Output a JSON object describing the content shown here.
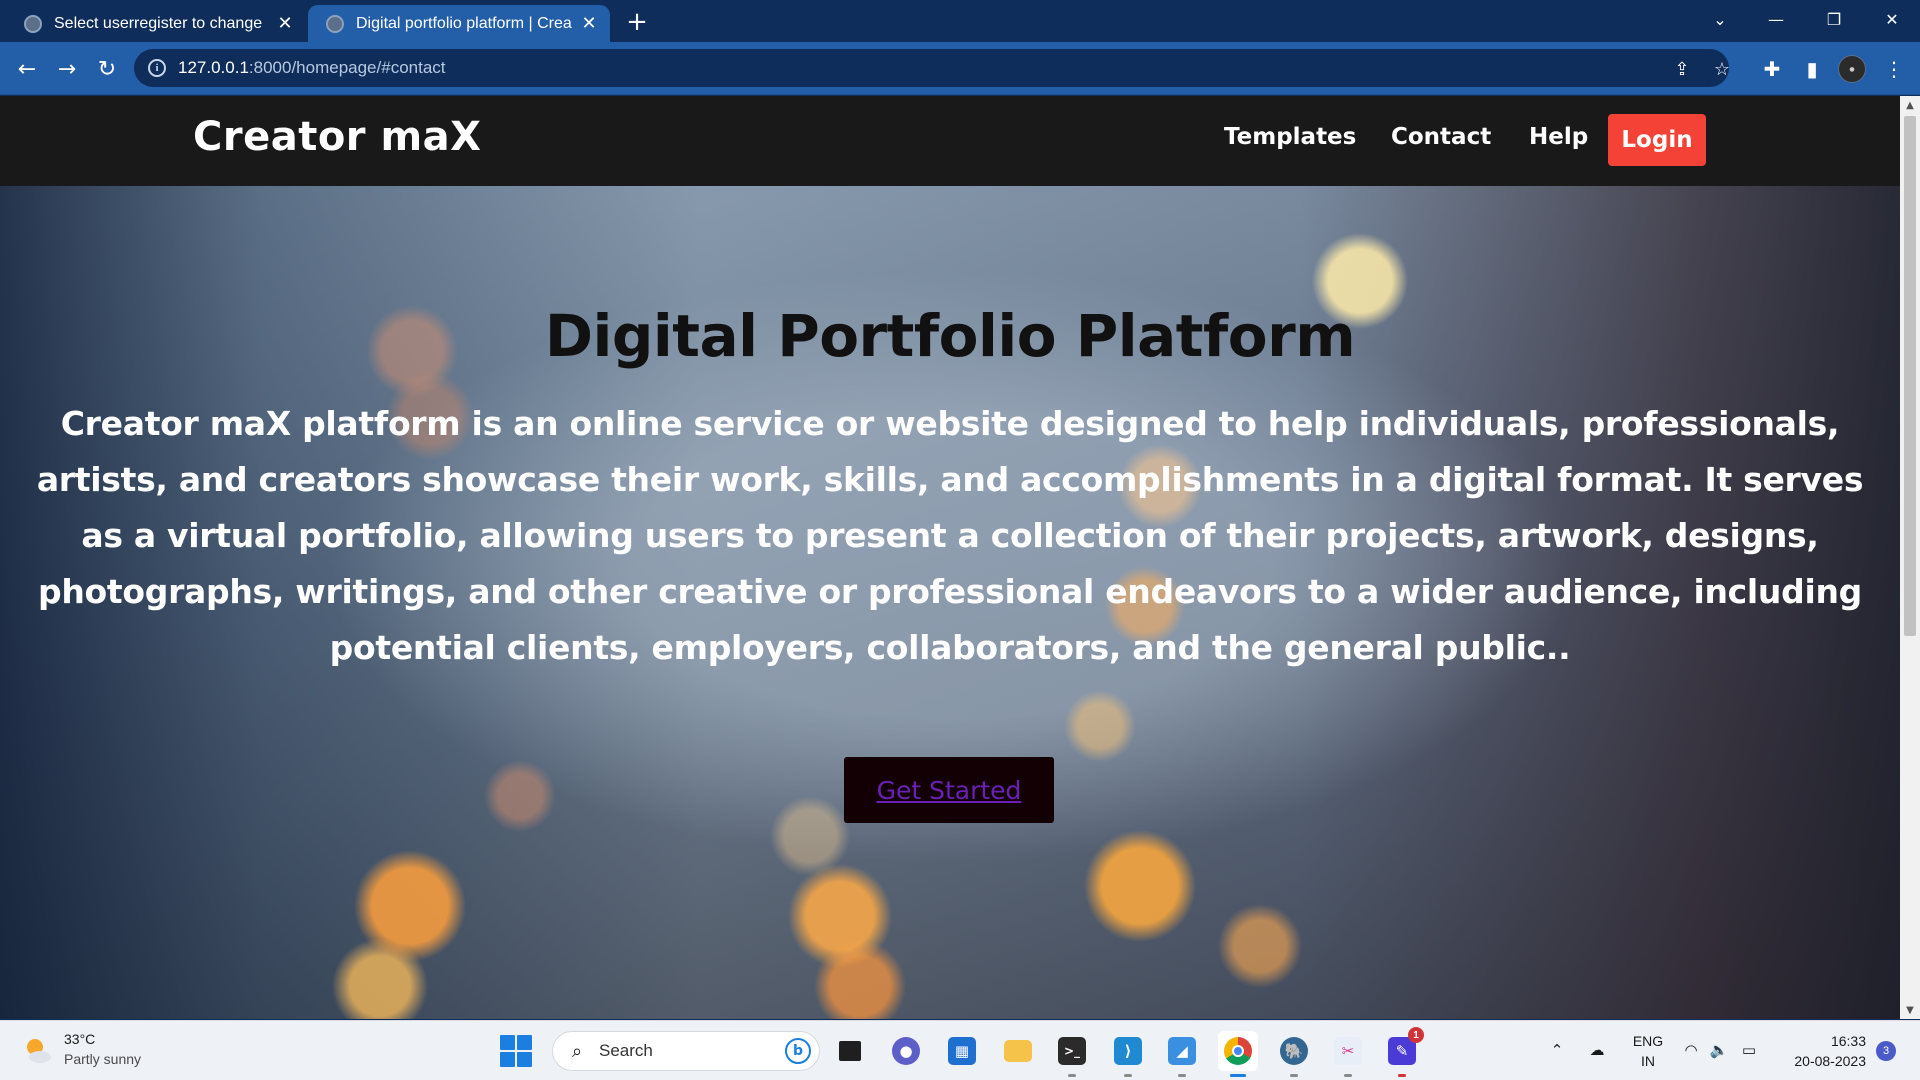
{
  "browser": {
    "tabs": [
      {
        "title": "Select userregister to change | Dj",
        "active": false
      },
      {
        "title": "Digital portfolio platform | Creato",
        "active": true
      }
    ],
    "new_tab": "+",
    "url_host": "127.0.0.1",
    "url_rest": ":8000/homepage/#contact"
  },
  "site": {
    "brand": "Creator maX",
    "nav": {
      "templates": "Templates",
      "contact": "Contact",
      "help": "Help",
      "login": "Login"
    },
    "hero": {
      "title": "Digital Portfolio Platform",
      "description": "Creator maX platform is an online service or website designed to help individuals, professionals, artists, and creators showcase their work, skills, and accomplishments in a digital format. It serves as a virtual portfolio, allowing users to present a collection of their projects, artwork, designs, photographs, writings, and other creative or professional endeavors to a wider audience, including potential clients, employers, collaborators, and the general public..",
      "cta": "Get Started"
    }
  },
  "taskbar": {
    "weather": {
      "temp": "33°C",
      "desc": "Partly sunny",
      "icon": "partly-sunny-icon"
    },
    "search_label": "Search",
    "apps": [
      "file-explorer-window",
      "teams-chat",
      "microsoft-store",
      "file-explorer",
      "terminal",
      "vscode",
      "remote-desktop",
      "chrome",
      "postgres-elephant",
      "snipping-tool",
      "paint"
    ],
    "paint_badge": "1",
    "lang_line1": "ENG",
    "lang_line2": "IN",
    "time": "16:33",
    "date": "20-08-2023",
    "notification_count": "3"
  },
  "colors": {
    "tab_strip": "#0f2d5a",
    "toolbar": "#235ea8",
    "header": "#191919",
    "login": "#f44336",
    "cta_bg": "#120004",
    "cta_text": "#6a1fb5"
  }
}
